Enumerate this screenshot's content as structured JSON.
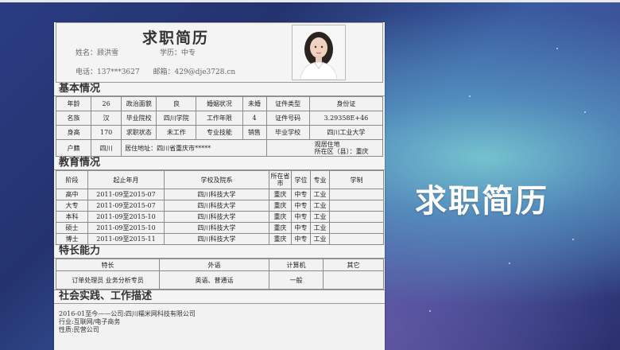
{
  "slide_title": "求职简历",
  "resume": {
    "title": "求职简历",
    "name_label": "姓名：",
    "name": "顾洪雪",
    "edu_label": "学历：",
    "edu": "中专",
    "phone_label": "电话：",
    "phone": "137***3627",
    "email_label": "邮箱：",
    "email": "429@dje3728.cn"
  },
  "sections": {
    "basic": "基本情况",
    "education": "教育情况",
    "skills": "特长能力",
    "work": "社会实践、工作描述"
  },
  "basic_rows": [
    [
      "年龄",
      "26",
      "政治面貌",
      "良",
      "婚姻状况",
      "未婚",
      "证件类型",
      "身份证"
    ],
    [
      "名族",
      "汉",
      "毕业院校",
      "四川学院",
      "工作年限",
      "4",
      "证件号码",
      "3.29358E+46"
    ],
    [
      "身高",
      "170",
      "求职状态",
      "未工作",
      "专业技能",
      "销售",
      "毕业学校",
      "四川工业大学"
    ]
  ],
  "basic_last": {
    "c1": "户籍",
    "c2": "四川",
    "c3": "居住地址：四川省重庆市*****",
    "c4a": "观居住地",
    "c4b": "所在区（县）：重庆"
  },
  "edu_header": [
    "阶段",
    "起止年月",
    "学校及院系",
    "所在省市",
    "学位",
    "专业",
    "学制"
  ],
  "edu_rows": [
    [
      "高中",
      "2011-09至2015-07",
      "四川科技大学",
      "重庆",
      "中专",
      "工业",
      ""
    ],
    [
      "大专",
      "2011-09至2015-07",
      "四川科技大学",
      "重庆",
      "中专",
      "工业",
      ""
    ],
    [
      "本科",
      "2011-09至2015-10",
      "四川科技大学",
      "重庆",
      "中专",
      "工业",
      ""
    ],
    [
      "硕士",
      "2011-09至2015-10",
      "四川科技大学",
      "重庆",
      "中专",
      "工业",
      ""
    ],
    [
      "博士",
      "2011-09至2015-11",
      "四川科技大学",
      "重庆",
      "中专",
      "工业",
      ""
    ]
  ],
  "skills_header": [
    "特长",
    "外语",
    "计算机",
    "其它"
  ],
  "skills_values": [
    "订单处理员 业务分析专员",
    "英语、普通话",
    "一般",
    ""
  ],
  "work_lines": [
    "2016-01至今——公司:四川糯米网科技有限公司",
    "行业:互联网/电子商务",
    "性质:民营公司"
  ]
}
